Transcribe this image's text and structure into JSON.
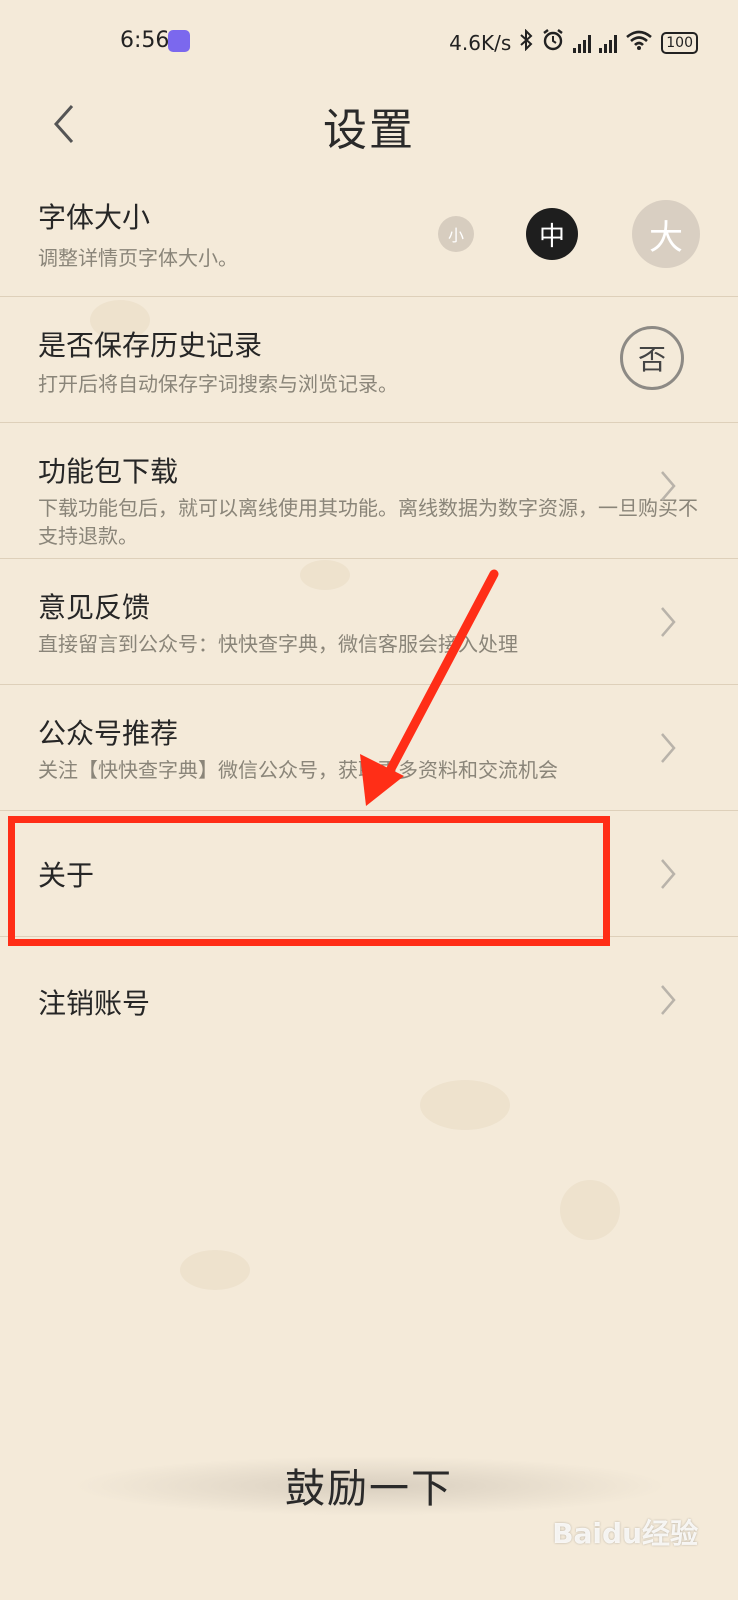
{
  "status_bar": {
    "time": "6:56",
    "net_speed": "4.6K/s",
    "battery": "100"
  },
  "header": {
    "title": "设置"
  },
  "settings": {
    "font_size": {
      "title": "字体大小",
      "subtitle": "调整详情页字体大小。",
      "options": [
        "小",
        "中",
        "大"
      ],
      "selected": "中"
    },
    "history": {
      "title": "是否保存历史记录",
      "subtitle": "打开后将自动保存字词搜索与浏览记录。",
      "toggle_label": "否"
    },
    "download": {
      "title": "功能包下载",
      "subtitle": "下载功能包后，就可以离线使用其功能。离线数据为数字资源，一旦购买不支持退款。"
    },
    "feedback": {
      "title": "意见反馈",
      "subtitle": "直接留言到公众号：快快查字典，微信客服会接入处理"
    },
    "official_account": {
      "title": "公众号推荐",
      "subtitle": "关注【快快查字典】微信公众号，获取更多资料和交流机会"
    },
    "about": {
      "title": "关于"
    },
    "delete_account": {
      "title": "注销账号"
    }
  },
  "footer": {
    "encourage_label": "鼓励一下"
  },
  "watermark": "Baidu经验",
  "colors": {
    "background": "#f4ead9",
    "annotation_red": "#ff2e17",
    "selected_ink": "#1e1e1e",
    "muted_circle": "#d9cfc2"
  }
}
